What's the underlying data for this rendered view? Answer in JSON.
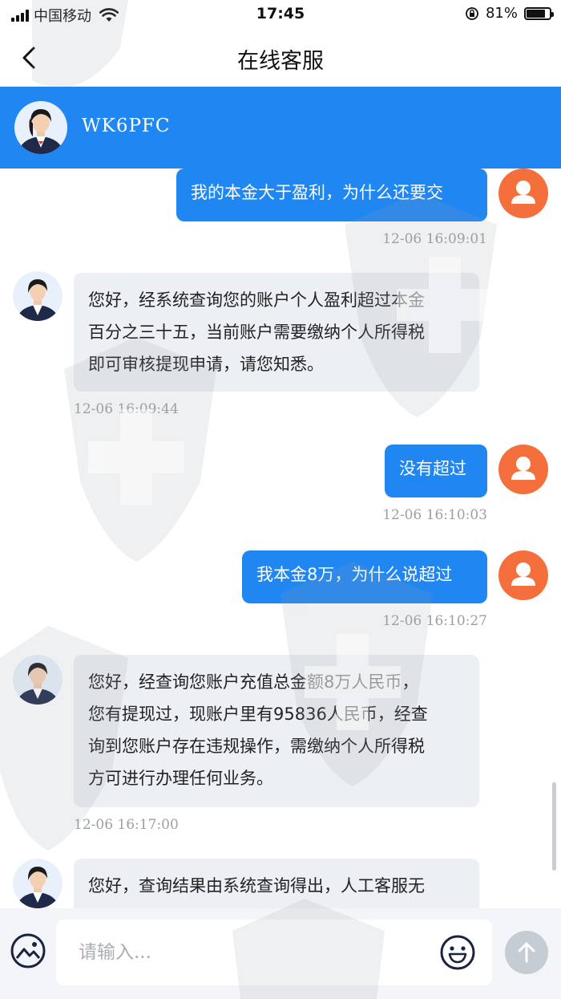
{
  "status_bar": {
    "carrier": "中国移动",
    "time": "17:45",
    "battery": "81%",
    "battery_level": 0.81
  },
  "nav": {
    "title": "在线客服"
  },
  "agent": {
    "name": "WK6PFC"
  },
  "messages": [
    {
      "from": "user",
      "text": "我的本金大于盈利，为什么还要交",
      "time": "12-06 16:09:01"
    },
    {
      "from": "agent",
      "lines": [
        "您好，经系统查询您的账户个人盈利超过本金",
        "百分之三十五，当前账户需要缴纳个人所得税",
        "即可审核提现申请，请您知悉。"
      ],
      "time": "12-06 16:09:44"
    },
    {
      "from": "user",
      "text": "没有超过",
      "time": "12-06 16:10:03"
    },
    {
      "from": "user",
      "text": "我本金8万，为什么说超过",
      "time": "12-06 16:10:27"
    },
    {
      "from": "agent",
      "lines": [
        "您好，经查询您账户充值总金额8万人民币，",
        "您有提现过，现账户里有95836人民币，经查",
        "询到您账户存在违规操作，需缴纳个人所得税",
        "方可进行办理任何业务。"
      ],
      "time": "12-06 16:17:00"
    },
    {
      "from": "agent",
      "lines": [
        "您好，查询结果由系统查询得出，人工客服无"
      ]
    }
  ],
  "input": {
    "placeholder": "请输入..."
  },
  "colors": {
    "brand_blue": "#1f86f2",
    "user_avatar": "#f56f3d",
    "agent_bubble": "#eceff4"
  }
}
